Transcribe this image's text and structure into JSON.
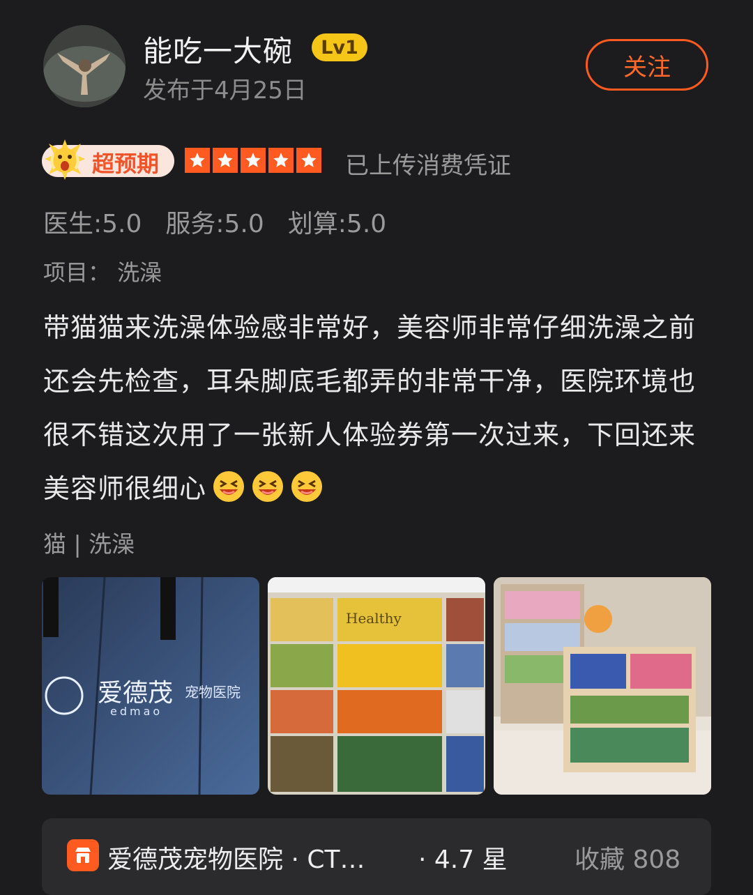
{
  "user": {
    "name": "能吃一大碗",
    "level": "Lv1",
    "publish_date": "发布于4月25日",
    "follow_label": "关注"
  },
  "rating": {
    "badge_label": "超预期",
    "stars": 5,
    "voucher_text": "已上传消费凭证",
    "scores": [
      {
        "text": "医生:5.0"
      },
      {
        "text": "服务:5.0"
      },
      {
        "text": "划算:5.0"
      }
    ]
  },
  "project": "项目：  洗澡",
  "review": {
    "text": "带猫猫来洗澡体验感非常好，美容师非常仔细洗澡之前还会先检查，耳朵脚底毛都弄的非常干净，医院环境也很不错这次用了一张新人体验券第一次过来，下回还来美容师很细心",
    "emoji": "laughing-face-icon",
    "emoji_count": 3
  },
  "tags": "猫 | 洗澡",
  "photos": [
    {
      "sign_text": "爱德茂",
      "sign_sub": "宠物医院",
      "sign_latin": "edmao"
    },
    {
      "shelf_text": "Healthy"
    },
    {}
  ],
  "shop": {
    "name": "爱德茂宠物医院 · CT…",
    "rating": "·  4.7 星",
    "favorites": "收藏 808"
  },
  "colors": {
    "accent": "#ff5a1f",
    "level_badge": "#f5c518",
    "background": "#1c1c1e"
  }
}
